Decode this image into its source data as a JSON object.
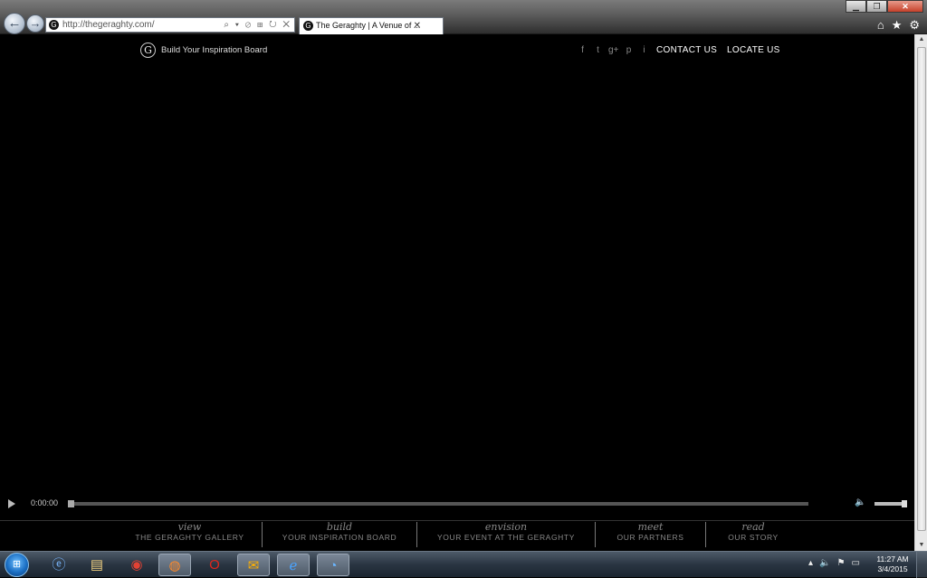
{
  "browser": {
    "url": "http://thegeraghty.com/",
    "tab_title": "The Geraghty | A Venue of ...",
    "tab_close": "✕",
    "back": "←",
    "forward": "→",
    "addr_icons": "⌕ ▾ ⊘ ⊞ ↻ ✕",
    "win_min": "▁",
    "win_max": "❐",
    "win_close": "✕",
    "icons": [
      "home-icon",
      "favorites-icon",
      "tools-icon"
    ]
  },
  "site": {
    "logo_letter": "G",
    "tagline": "Build Your Inspiration Board",
    "social": [
      "f",
      "t",
      "g+",
      "p",
      "i"
    ],
    "contact": "CONTACT US",
    "locate": "LOCATE US"
  },
  "video": {
    "time": "0:00:00",
    "progress": 0,
    "volume": 1.0
  },
  "bottom_nav": [
    {
      "top": "view",
      "sub": "THE GERAGHTY GALLERY"
    },
    {
      "top": "build",
      "sub": "YOUR INSPIRATION BOARD"
    },
    {
      "top": "envision",
      "sub": "YOUR EVENT AT THE GERAGHTY"
    },
    {
      "top": "meet",
      "sub": "OUR PARTNERS"
    },
    {
      "top": "read",
      "sub": "OUR STORY"
    }
  ],
  "taskbar": {
    "apps": [
      "ie-icon",
      "explorer-icon",
      "chrome-icon",
      "firefox-icon",
      "opera-icon",
      "outlook-icon",
      "ie-icon",
      "messenger-icon"
    ],
    "time": "11:27 AM",
    "date": "3/4/2015"
  },
  "colors": {
    "background": "#000000",
    "nav_text": "#888888",
    "link_text": "#ffffff"
  }
}
